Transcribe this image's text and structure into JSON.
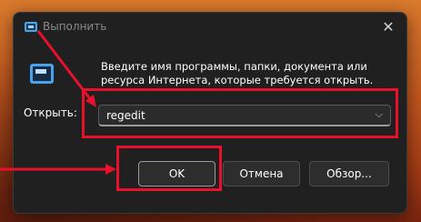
{
  "dialog": {
    "title": "Выполнить",
    "close_glyph": "✕",
    "description": "Введите имя программы, папки, документа или ресурса Интернета, которые требуется открыть.",
    "open_label": "Открыть:",
    "open_value": "regedit",
    "chevron": "⌵"
  },
  "buttons": {
    "ok": "OK",
    "cancel": "Отмена",
    "browse": "Обзор..."
  },
  "icons": {
    "title": "run-icon",
    "main": "run-icon",
    "close": "close-icon",
    "dropdown": "chevron-down-icon"
  },
  "colors": {
    "highlight": "#e8102a",
    "dialog_bg": "#202020",
    "accent": "#4aa3e8"
  }
}
